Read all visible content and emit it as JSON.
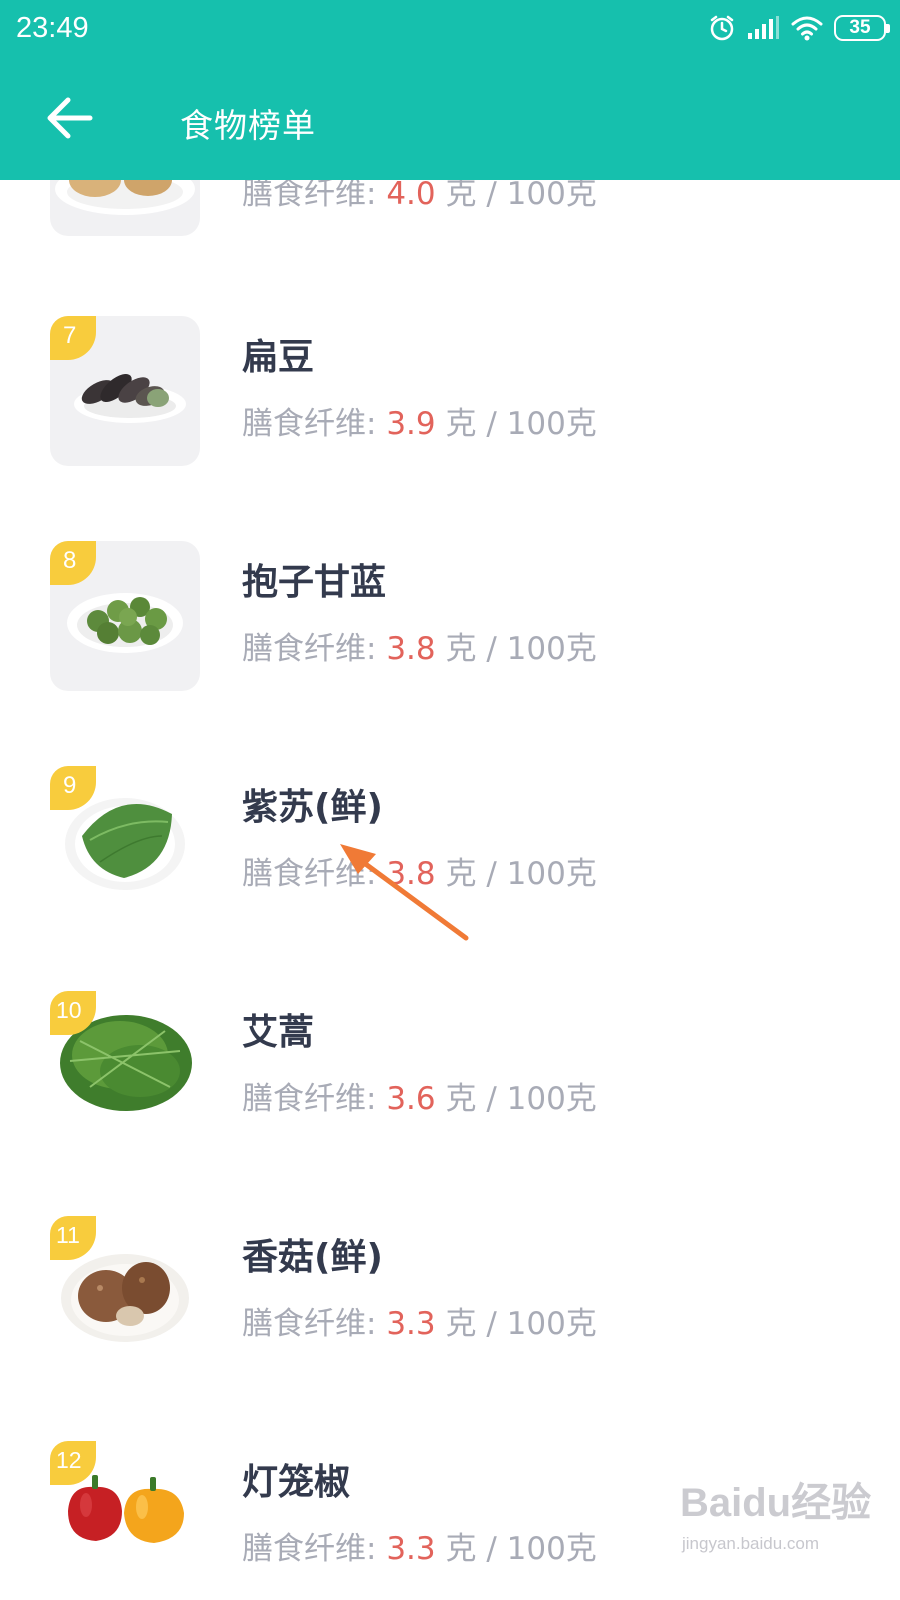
{
  "status_bar": {
    "time": "23:49",
    "battery": "35",
    "icons": [
      "alarm-icon",
      "signal-icon",
      "wifi-icon",
      "battery-icon"
    ]
  },
  "header": {
    "title": "食物榜单",
    "back_icon": "arrow-left-icon"
  },
  "colors": {
    "header_bg": "#16c0ad",
    "value": "#e2635b",
    "rank_badge": "#f8cc3d",
    "annotation_arrow": "#f07a36"
  },
  "list": {
    "items": [
      {
        "rank": "",
        "name": "",
        "label": "膳食纤维:",
        "value": "4.0",
        "unit": "克 / 100克",
        "image": "potato"
      },
      {
        "rank": "7",
        "name": "扁豆",
        "label": "膳食纤维:",
        "value": "3.9",
        "unit": "克 / 100克",
        "image": "lentil-pods"
      },
      {
        "rank": "8",
        "name": "抱子甘蓝",
        "label": "膳食纤维:",
        "value": "3.8",
        "unit": "克 / 100克",
        "image": "brussels-sprouts"
      },
      {
        "rank": "9",
        "name": "紫苏(鲜)",
        "label": "膳食纤维:",
        "value": "3.8",
        "unit": "克 / 100克",
        "image": "perilla-leaves"
      },
      {
        "rank": "10",
        "name": "艾蒿",
        "label": "膳食纤维:",
        "value": "3.6",
        "unit": "克 / 100克",
        "image": "mugwort"
      },
      {
        "rank": "11",
        "name": "香菇(鲜)",
        "label": "膳食纤维:",
        "value": "3.3",
        "unit": "克 / 100克",
        "image": "shiitake"
      },
      {
        "rank": "12",
        "name": "灯笼椒",
        "label": "膳食纤维:",
        "value": "3.3",
        "unit": "克 / 100克",
        "image": "bell-peppers"
      }
    ]
  },
  "watermark": {
    "logo": "Baidu经验",
    "url": "jingyan.baidu.com"
  }
}
